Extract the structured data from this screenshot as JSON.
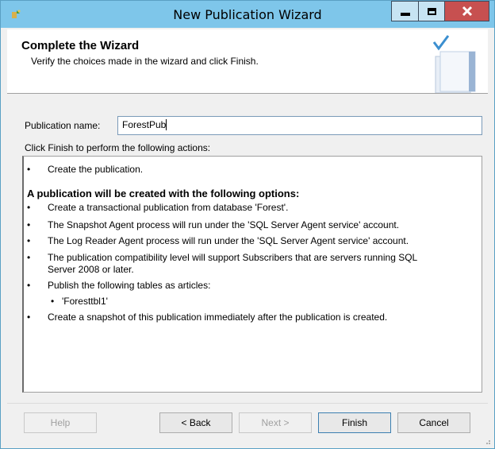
{
  "window": {
    "title": "New Publication Wizard"
  },
  "header": {
    "title": "Complete the Wizard",
    "subtitle": "Verify the choices made in the wizard and click Finish."
  },
  "form": {
    "publication_name_label": "Publication name:",
    "publication_name_value": "ForestPub",
    "instruction": "Click Finish to perform the following actions:"
  },
  "actions": {
    "first_item": "Create the publication.",
    "options_heading": "A publication will be created with the following options:",
    "items": [
      "Create a transactional publication from database 'Forest'.",
      "The Snapshot Agent process will run under the 'SQL Server Agent service' account.",
      "The Log Reader Agent process will run under the 'SQL Server Agent service' account.",
      "The publication compatibility level will support Subscribers that are servers running SQL",
      "Server 2008 or later.",
      "Publish the following tables as articles:",
      "'Foresttbl1'",
      "Create a snapshot of this publication immediately after the publication is created."
    ]
  },
  "buttons": {
    "help": "Help",
    "back": "< Back",
    "next": "Next >",
    "finish": "Finish",
    "cancel": "Cancel"
  },
  "icons": {
    "app": "wizard-app-icon",
    "minimize": "minimize-icon",
    "maximize": "maximize-icon",
    "close": "close-icon",
    "header": "wizard-checkmark-book-icon"
  },
  "colors": {
    "titlebar": "#7ec6ea",
    "close_button": "#c75050",
    "dialog_bg": "#f0f0f0"
  }
}
